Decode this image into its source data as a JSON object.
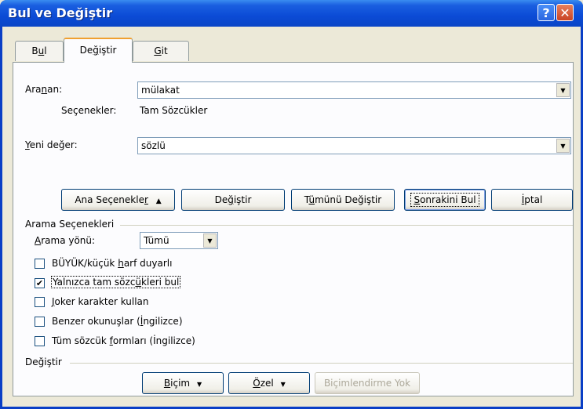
{
  "window": {
    "title": "Bul ve Değiştir"
  },
  "tabs": [
    {
      "pre": "B",
      "ul": "u",
      "post": "l"
    },
    {
      "pre": "De",
      "ul": "ğ",
      "post": "iştir"
    },
    {
      "pre": "",
      "ul": "G",
      "post": "it"
    }
  ],
  "find": {
    "label_pre": "Ara",
    "label_ul": "n",
    "label_post": "an:",
    "value": "mülakat",
    "options_label": "Seçenekler:",
    "options_value": "Tam Sözcükler"
  },
  "replace": {
    "label_pre": "",
    "label_ul": "Y",
    "label_post": "eni değer:",
    "value": "sözlü"
  },
  "buttons": {
    "less": {
      "pre": "Ana Seçenekle",
      "ul": "r",
      "post": "",
      "arrow": "▲"
    },
    "replace": {
      "pre": "De",
      "ul": "ğ",
      "post": "iştir"
    },
    "replace_all": {
      "pre": "T",
      "ul": "ü",
      "post": "münü Değiştir"
    },
    "find_next": {
      "pre": "",
      "ul": "S",
      "post": "onrakini Bul"
    },
    "cancel": {
      "pre": "",
      "ul": "İ",
      "post": "ptal"
    }
  },
  "search_options": {
    "header": "Arama Seçenekleri",
    "direction_label_pre": "",
    "direction_label_ul": "A",
    "direction_label_post": "rama yönü:",
    "direction_value": "Tümü",
    "checkboxes": [
      {
        "pre": "BÜYÜK/küçük ",
        "ul": "h",
        "post": "arf duyarlı",
        "checked": false
      },
      {
        "pre": "Yalnızca tam sözc",
        "ul": "ü",
        "post": "kleri bul",
        "checked": true
      },
      {
        "pre": "",
        "ul": "J",
        "post": "oker karakter kullan",
        "checked": false
      },
      {
        "pre": "Benzer okunuşlar (",
        "ul": "İ",
        "post": "ngilizce)",
        "checked": false
      },
      {
        "pre": "Tüm sözcük ",
        "ul": "f",
        "post": "ormları (İngilizce)",
        "checked": false
      }
    ]
  },
  "replace_section": {
    "header": "Değiştir",
    "format": {
      "pre": "",
      "ul": "B",
      "post": "içim",
      "arrow": "▼"
    },
    "special": {
      "pre": "",
      "ul": "Ö",
      "post": "zel",
      "arrow": "▼"
    },
    "no_format": "Biçimlendirme Yok"
  },
  "icons": {
    "help": "?",
    "close": "✕",
    "dropdown": "▼",
    "check": "✔"
  }
}
